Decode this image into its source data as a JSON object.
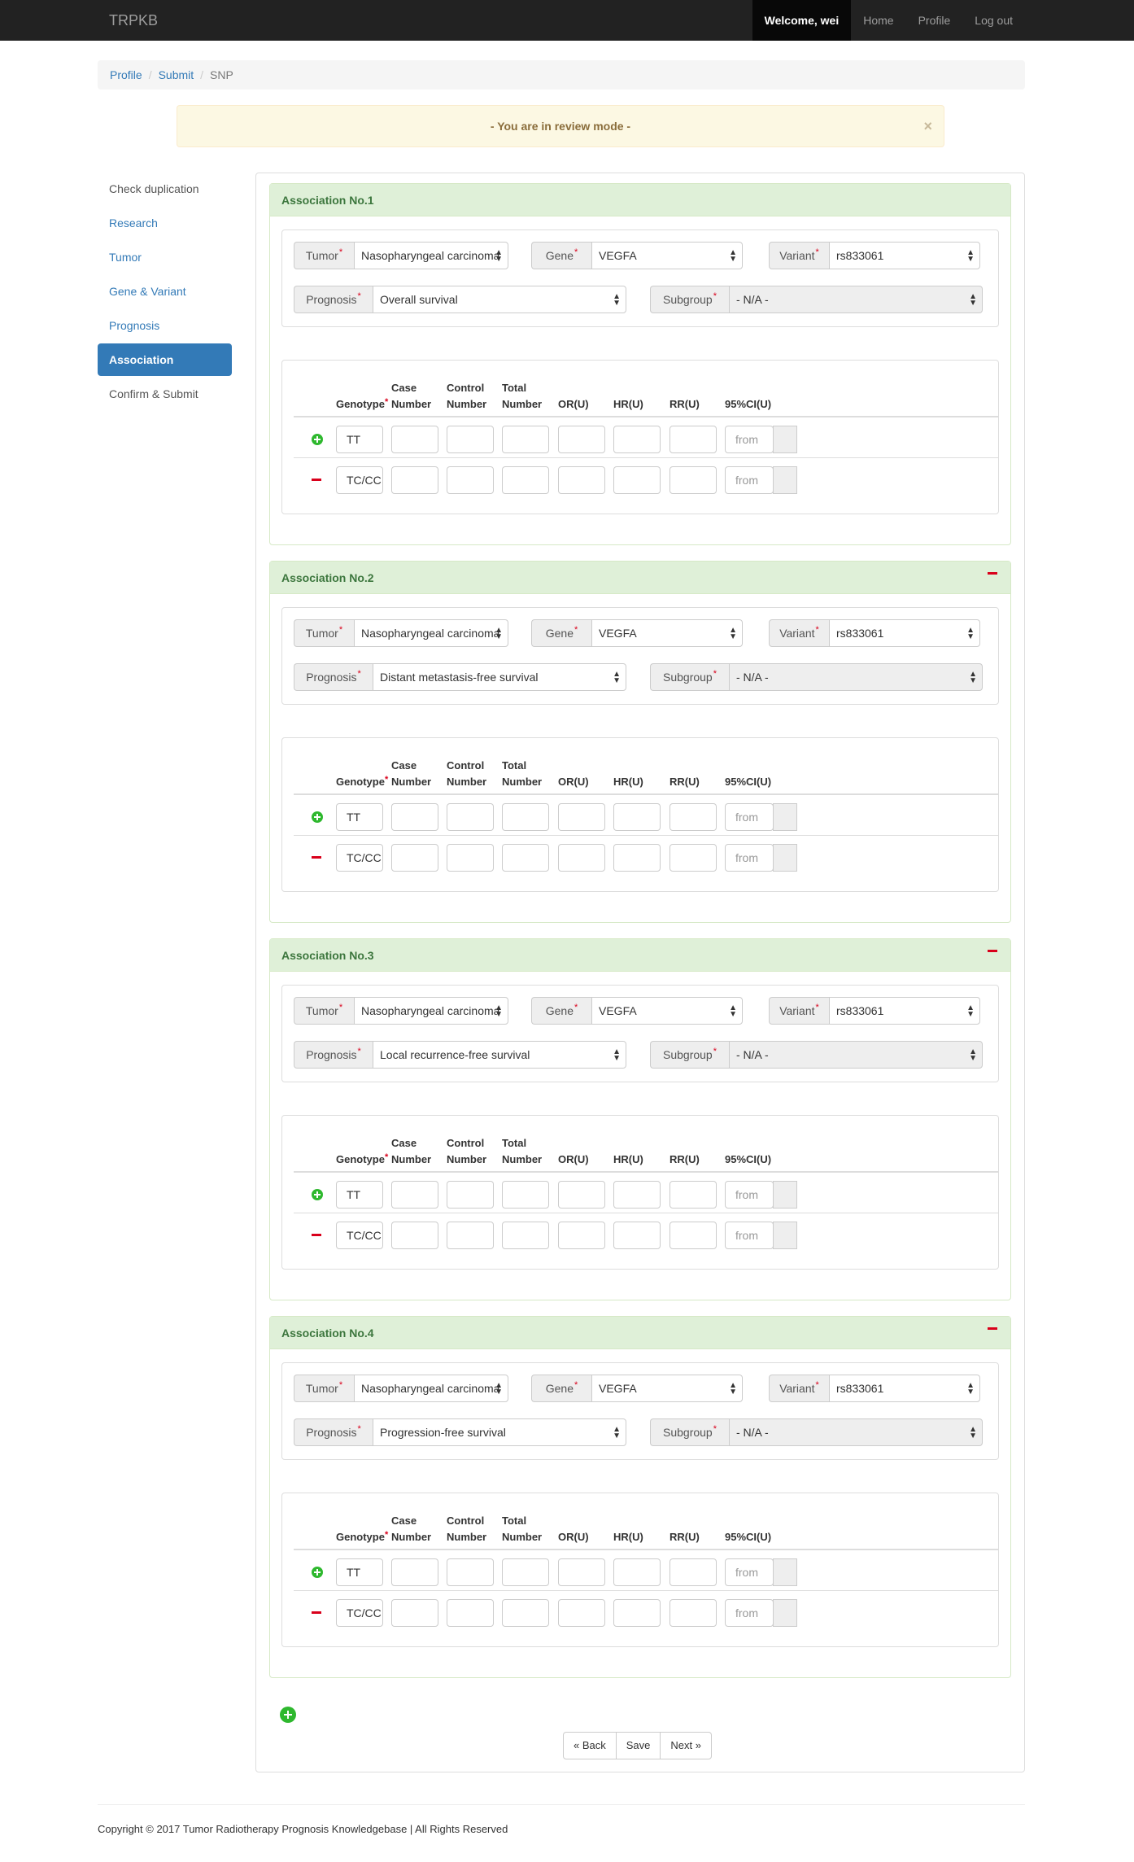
{
  "navbar": {
    "brand": "TRPKB",
    "welcome": "Welcome, wei",
    "home": "Home",
    "profile": "Profile",
    "logout": "Log out"
  },
  "breadcrumb": {
    "items": [
      "Profile",
      "Submit",
      "SNP"
    ]
  },
  "alert": {
    "text": "- You are in review mode -",
    "close": "×"
  },
  "sidebar": {
    "items": [
      {
        "label": "Check duplication"
      },
      {
        "label": "Research"
      },
      {
        "label": "Tumor"
      },
      {
        "label": "Gene & Variant"
      },
      {
        "label": "Prognosis"
      },
      {
        "label": "Association"
      },
      {
        "label": "Confirm & Submit"
      }
    ]
  },
  "labels": {
    "tumor": "Tumor",
    "gene": "Gene",
    "variant": "Variant",
    "prognosis": "Prognosis",
    "subgroup": "Subgroup",
    "required": "*",
    "col_genotype": "Genotype",
    "col_case_1": "Case",
    "col_case_2": "Number",
    "col_control_1": "Control",
    "col_control_2": "Number",
    "col_total_1": "Total",
    "col_total_2": "Number",
    "col_or": "OR(U)",
    "col_hr": "HR(U)",
    "col_rr": "RR(U)",
    "col_ci": "95%CI(U)",
    "ci_placeholder": "from"
  },
  "associations": [
    {
      "title": "Association No.1",
      "tumor": "Nasopharyngeal carcinoma",
      "gene": "VEGFA",
      "variant": "rs833061",
      "prognosis": "Overall survival",
      "subgroup": "- N/A -",
      "rows": [
        {
          "genotype": "TT"
        },
        {
          "genotype": "TC/CC"
        }
      ]
    },
    {
      "title": "Association No.2",
      "tumor": "Nasopharyngeal carcinoma",
      "gene": "VEGFA",
      "variant": "rs833061",
      "prognosis": "Distant metastasis-free survival",
      "subgroup": "- N/A -",
      "rows": [
        {
          "genotype": "TT"
        },
        {
          "genotype": "TC/CC"
        }
      ]
    },
    {
      "title": "Association No.3",
      "tumor": "Nasopharyngeal carcinoma",
      "gene": "VEGFA",
      "variant": "rs833061",
      "prognosis": "Local recurrence-free survival",
      "subgroup": "- N/A -",
      "rows": [
        {
          "genotype": "TT"
        },
        {
          "genotype": "TC/CC"
        }
      ]
    },
    {
      "title": "Association No.4",
      "tumor": "Nasopharyngeal carcinoma",
      "gene": "VEGFA",
      "variant": "rs833061",
      "prognosis": "Progression-free survival",
      "subgroup": "- N/A -",
      "rows": [
        {
          "genotype": "TT"
        },
        {
          "genotype": "TC/CC"
        }
      ]
    }
  ],
  "buttons": {
    "back": "« Back",
    "save": "Save",
    "next": "Next »"
  },
  "footer": {
    "text": "Copyright © 2017 Tumor Radiotherapy Prognosis Knowledgebase | All Rights Reserved"
  },
  "colors": {
    "navbar": "#222222",
    "link": "#337ab7",
    "panel_heading": "#dff0d8",
    "panel_text": "#3c763d",
    "alert_bg": "#fcf8e3",
    "add_green": "#2eb82e",
    "remove_red": "#d9001b"
  }
}
